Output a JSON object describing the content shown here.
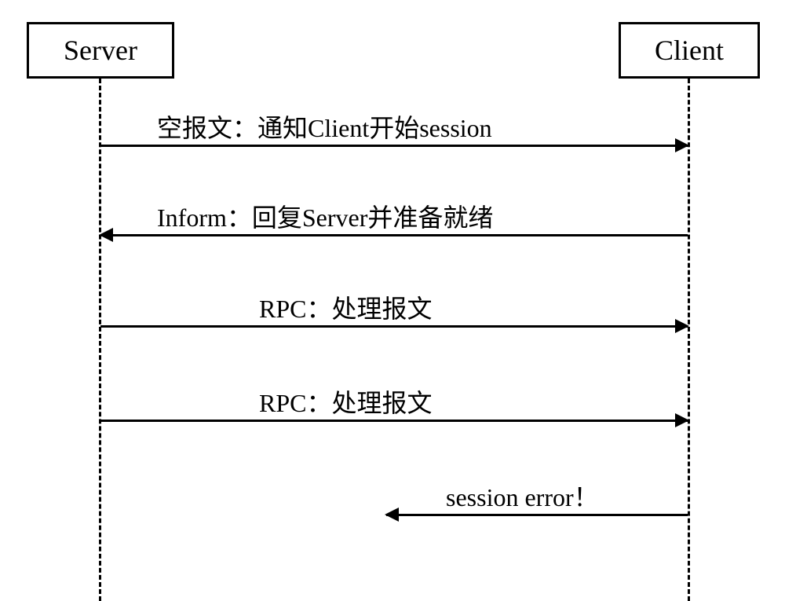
{
  "participants": {
    "server": "Server",
    "client": "Client"
  },
  "messages": {
    "msg1": "空报文：通知Client开始session",
    "msg2": "Inform：回复Server并准备就绪",
    "msg3": "RPC：处理报文",
    "msg4": "RPC：处理报文",
    "msg5": "session error！"
  }
}
